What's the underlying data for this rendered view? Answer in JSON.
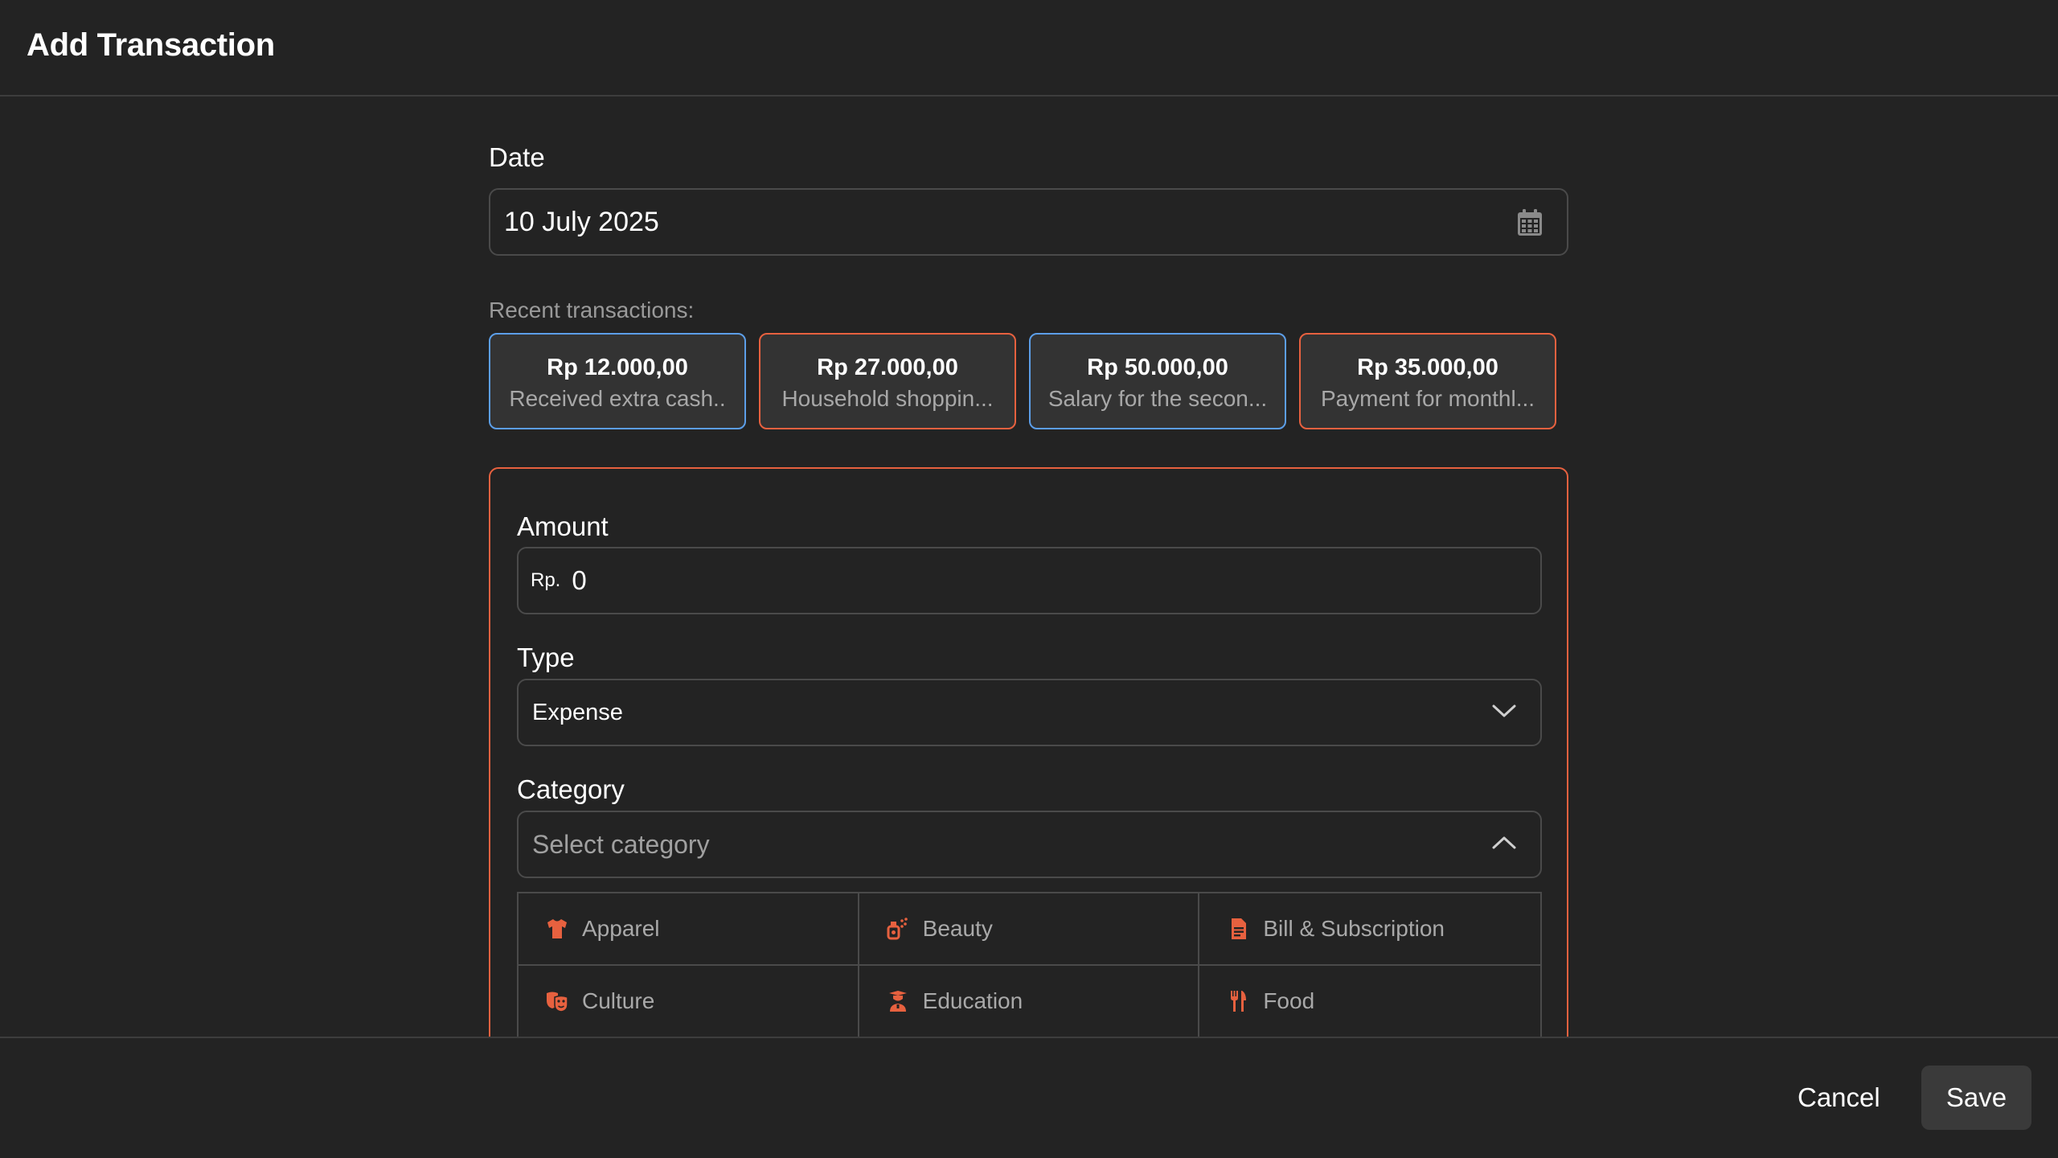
{
  "header": {
    "title": "Add Transaction"
  },
  "date": {
    "label": "Date",
    "value": "10 July 2025",
    "icon": "calendar-icon"
  },
  "recent": {
    "label": "Recent transactions:",
    "items": [
      {
        "amount": "Rp 12.000,00",
        "description": "Received extra cash..",
        "kind": "income",
        "border_color": "#5c9ee8"
      },
      {
        "amount": "Rp 27.000,00",
        "description": "Household shoppin...",
        "kind": "expense",
        "border_color": "#e7613f"
      },
      {
        "amount": "Rp 50.000,00",
        "description": "Salary for the secon...",
        "kind": "income",
        "border_color": "#5c9ee8"
      },
      {
        "amount": "Rp 35.000,00",
        "description": "Payment for monthl...",
        "kind": "expense",
        "border_color": "#e7613f"
      }
    ]
  },
  "form": {
    "accent_color": "#e7613f",
    "amount": {
      "label": "Amount",
      "prefix": "Rp.",
      "value": "0"
    },
    "type": {
      "label": "Type",
      "value": "Expense",
      "icon": "chevron-down-icon"
    },
    "category": {
      "label": "Category",
      "placeholder": "Select category",
      "icon": "chevron-up-icon",
      "options": [
        {
          "label": "Apparel",
          "icon": "shirt-icon"
        },
        {
          "label": "Beauty",
          "icon": "perfume-icon"
        },
        {
          "label": "Bill & Subscription",
          "icon": "receipt-icon"
        },
        {
          "label": "Culture",
          "icon": "theater-masks-icon"
        },
        {
          "label": "Education",
          "icon": "graduate-icon"
        },
        {
          "label": "Food",
          "icon": "utensils-icon"
        }
      ]
    }
  },
  "footer": {
    "cancel_label": "Cancel",
    "save_label": "Save"
  }
}
